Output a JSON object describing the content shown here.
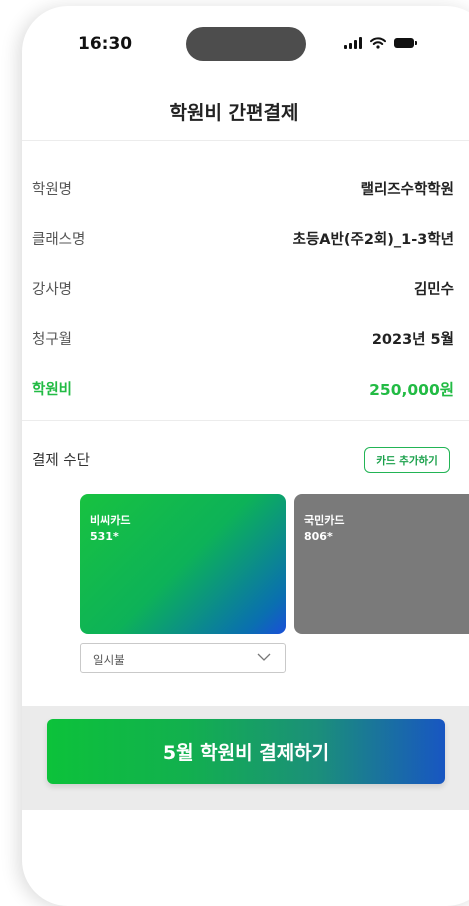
{
  "status_bar": {
    "time": "16:30"
  },
  "header": {
    "title": "학원비 간편결제"
  },
  "info": [
    {
      "label": "학원명",
      "value": "랠리즈수학학원"
    },
    {
      "label": "클래스명",
      "value": "초등A반(주2회)_1-3학년"
    },
    {
      "label": "강사명",
      "value": "김민수"
    },
    {
      "label": "청구월",
      "value": "2023년 5월"
    },
    {
      "label": "학원비",
      "value": "250,000원"
    }
  ],
  "payment": {
    "label": "결제 수단",
    "add_card_label": "카드 추가하기",
    "cards": [
      {
        "name": "비씨카드",
        "number": "531*"
      },
      {
        "name": "국민카드",
        "number": "806*"
      }
    ],
    "installment": "일시불"
  },
  "pay_button_label": "5월 학원비 결제하기",
  "colors": {
    "accent_green": "#22bb44",
    "card_inactive": "#7a7a7a",
    "gradient_start": "#0cc23a",
    "gradient_end": "#1856c2"
  },
  "icons": [
    "signal-icon",
    "wifi-icon",
    "battery-icon",
    "chevron-down-icon"
  ]
}
